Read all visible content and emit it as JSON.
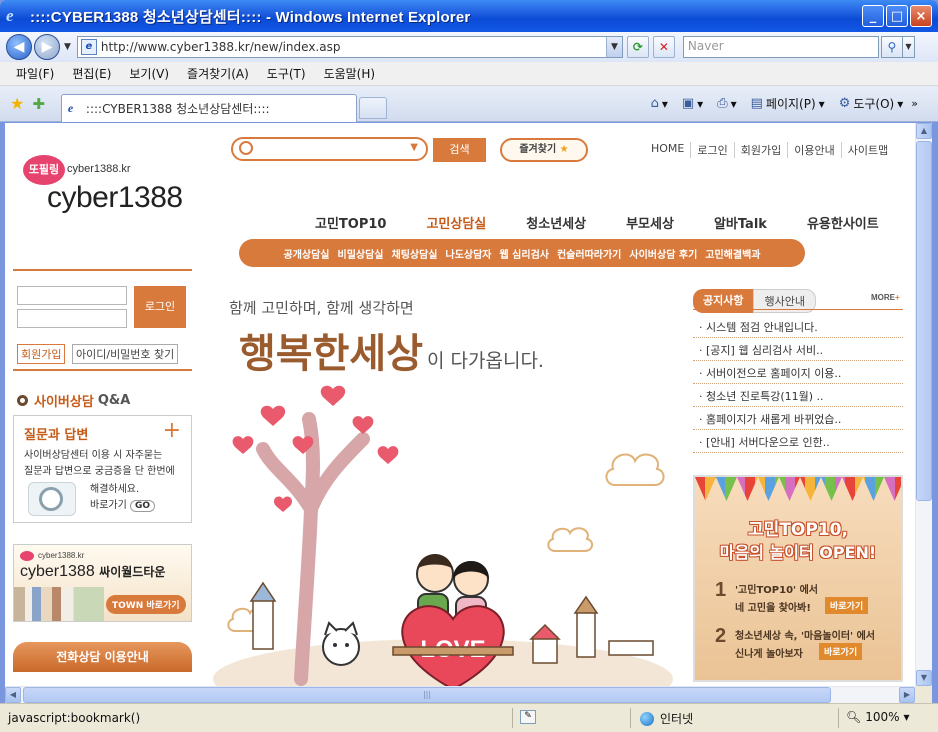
{
  "window": {
    "title": "::::CYBER1388 청소년상담센터:::: - Windows Internet Explorer",
    "ie_logo": "e",
    "minimize": "_",
    "maximize": "□",
    "close": "×"
  },
  "address": {
    "url": "http://www.cyber1388.kr/new/index.asp",
    "search_placeholder": "Naver"
  },
  "menu": [
    "파일(F)",
    "편집(E)",
    "보기(V)",
    "즐겨찾기(A)",
    "도구(T)",
    "도움말(H)"
  ],
  "tab": {
    "label": "::::CYBER1388 청소년상담센터::::"
  },
  "commands": {
    "page": "페이지(P)",
    "tools": "도구(O)"
  },
  "site": {
    "logo_badge": "또필링",
    "logo_small": "cyber1388.kr",
    "logo_big": "cyber1388",
    "search_button": "검색",
    "favorites_button": "즐겨찾기",
    "util_links": [
      "HOME",
      "로그인",
      "회원가입",
      "이용안내",
      "사이트맵"
    ],
    "main_nav": [
      "고민TOP10",
      "고민상담실",
      "청소년세상",
      "부모세상",
      "알바Talk",
      "유용한사이트"
    ],
    "main_nav_active": 1,
    "sub_nav": [
      "공개상담실",
      "비밀상담실",
      "채팅상담실",
      "나도상담자",
      "웹 심리검사",
      "컨슬러따라가기",
      "사이버상담 후기",
      "고민해결백과"
    ],
    "login_button": "로그인",
    "join_button": "회원가입",
    "find_button": "아이디/비밀번호 찾기",
    "qa_title": "사이버상담",
    "qa_suffix": "Q&A",
    "qa_box": {
      "heading": "질문과 답변",
      "line1": "사이버상담센터 이용 시 자주묻는",
      "line2": "질문과 답변으로 궁금증을 단 한번에",
      "line3": "해결하세요.",
      "go_label": "바로가기",
      "go_btn": "GO"
    },
    "town": {
      "small": "cyber1388.kr",
      "name": "cyber1388",
      "suffix": "싸이월드타운",
      "button": "TOWN 바로가기"
    },
    "phone_button": "전화상담 이용안내",
    "hero": {
      "sub": "함께 고민하며, 함께 생각하면",
      "main": "행복한세상",
      "rest": "이 다가옵니다.",
      "love": "LOVE"
    },
    "notice": {
      "tab_active": "공지사항",
      "tab_other": "행사안내",
      "more": "MORE",
      "items": [
        "시스템 점검 안내입니다.",
        "[공지] 웹 심리검사 서비..",
        "서버이전으로 홈페이지 이용..",
        "청소년 진로특강(11월) ..",
        "홈페이지가 새롭게 바뀌었습..",
        "[안내] 서버다운으로 인한.."
      ]
    },
    "banner": {
      "title1": "고민TOP10,",
      "title2": "마음의 놀이터 OPEN!",
      "n1": "1",
      "l1a": "'고민TOP10' 에서",
      "l1b": "네 고민을 찾아봐!",
      "b1": "바로가기",
      "n2": "2",
      "l2a": "청소년세상 속, '마음놀이터' 에서",
      "l2b": "신나게 놀아보자",
      "b2": "바로가기"
    }
  },
  "status": {
    "text": "javascript:bookmark()",
    "zone": "인터넷",
    "zoom": "100%"
  }
}
